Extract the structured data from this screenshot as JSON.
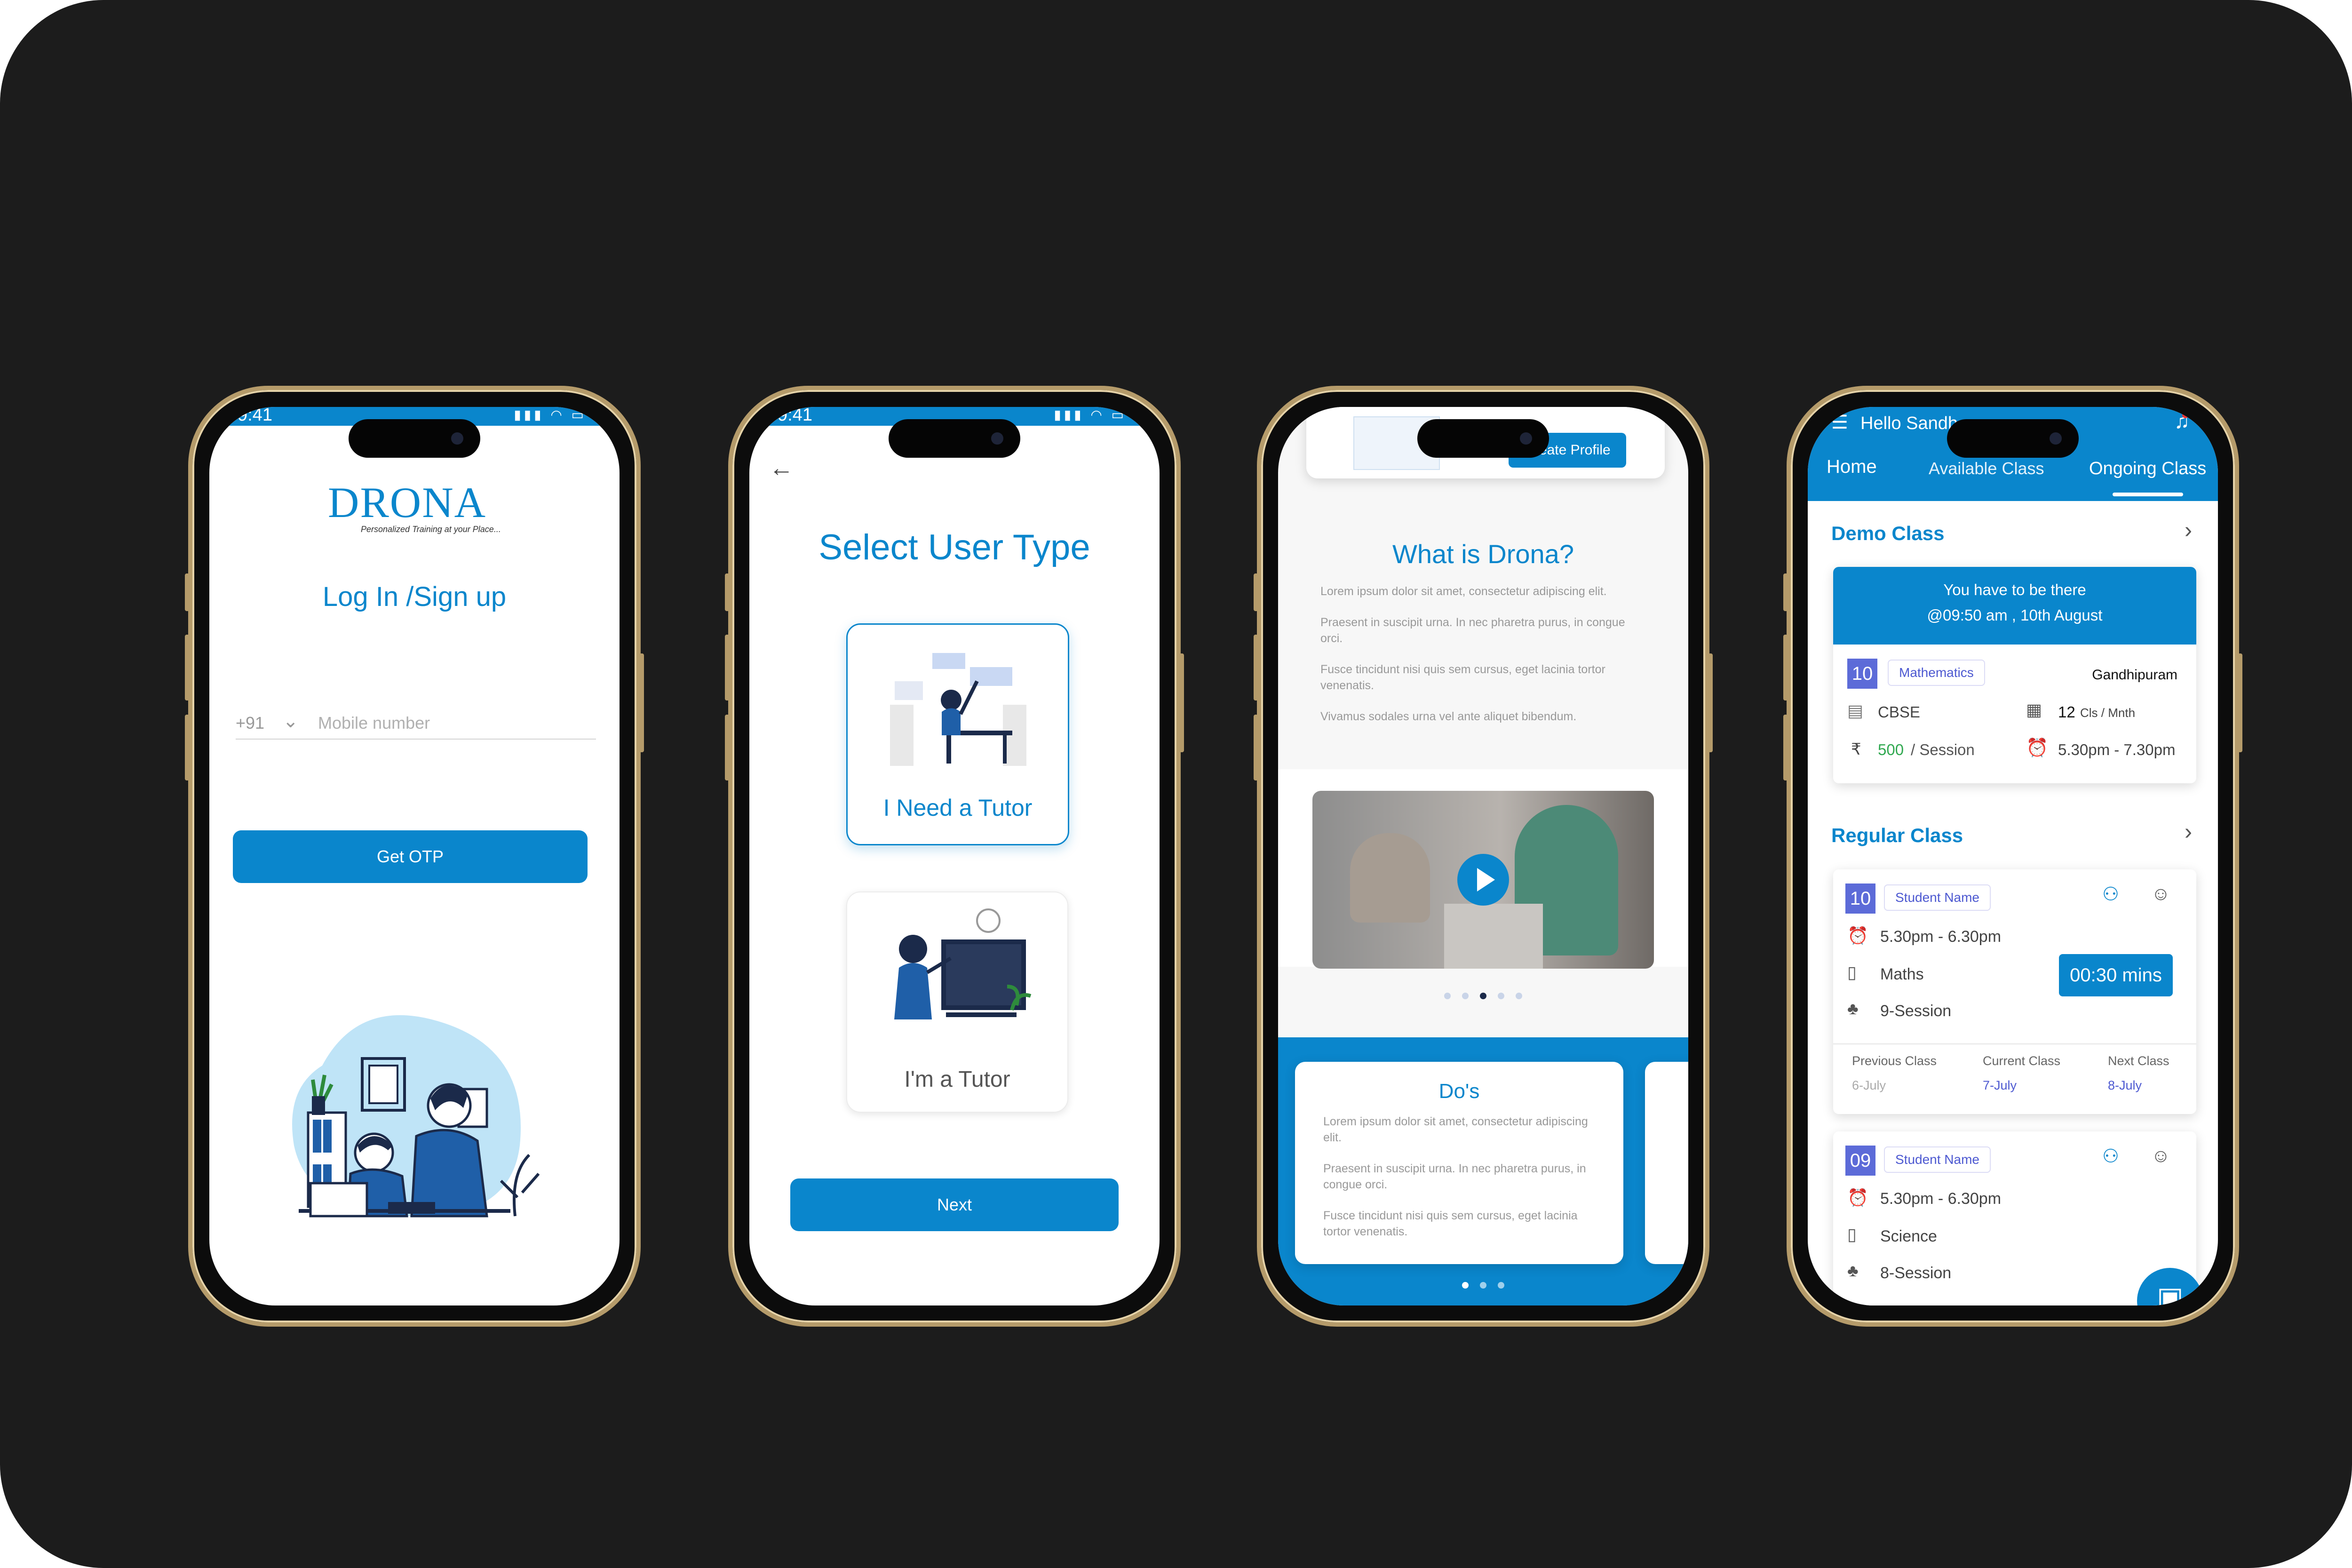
{
  "colors": {
    "brand": "#0a86cc",
    "background": "#1c1c1c",
    "accent_indigo": "#5c6bd8",
    "price_green": "#2fa84f"
  },
  "phone1": {
    "status_time": "9:41",
    "logo": "DRONA",
    "tagline": "Personalized Training at your Place...",
    "title": "Log In /Sign up",
    "country_code": "+91",
    "mobile_placeholder": "Mobile number",
    "otp_button": "Get OTP"
  },
  "phone2": {
    "status_time": "9:41",
    "title": "Select User Type",
    "option_student": "I Need a Tutor",
    "option_tutor": "I'm a Tutor",
    "next_button": "Next"
  },
  "phone3": {
    "top_button": "Create Profile",
    "title": "What is Drona?",
    "bullets": [
      "Lorem ipsum dolor sit amet, consectetur adipiscing elit.",
      "Praesent in suscipit urna. In nec pharetra purus, in congue orci.",
      "Fusce tincidunt nisi quis sem cursus, eget lacinia tortor venenatis.",
      "Vivamus sodales urna vel ante aliquet bibendum."
    ],
    "dos_title": "Do's",
    "dos_bullets": [
      "Lorem ipsum dolor sit amet, consectetur adipiscing elit.",
      "Praesent in suscipit urna. In nec pharetra purus, in congue orci.",
      "Fusce tincidunt nisi quis sem cursus, eget lacinia tortor venenatis."
    ]
  },
  "phone4": {
    "greeting": "Hello Sandh",
    "tabs": [
      "Home",
      "Available Class",
      "Ongoing Class"
    ],
    "demo_section": "Demo Class",
    "demo_notice_line1": "You have to be there",
    "demo_notice_line2": "@09:50 am , 10th August",
    "demo_grade": "10",
    "demo_subject": "Mathematics",
    "demo_location": "Gandhipuram",
    "demo_board": "CBSE",
    "demo_classes_count": "12",
    "demo_classes_unit": "Cls / Mnth",
    "demo_currency": "₹",
    "demo_price": "500",
    "demo_price_unit": "/ Session",
    "demo_time": "5.30pm - 7.30pm",
    "regular_section": "Regular Class",
    "class1": {
      "grade": "10",
      "name": "Student Name",
      "time": "5.30pm - 6.30pm",
      "subject": "Maths",
      "sessions": "9-Session",
      "timer": "00:30 mins",
      "prev_label": "Previous Class",
      "prev_value": "6-July",
      "curr_label": "Current Class",
      "curr_value": "7-July",
      "next_label": "Next Class",
      "next_value": "8-July"
    },
    "class2": {
      "grade": "09",
      "name": "Student Name",
      "time": "5.30pm - 6.30pm",
      "subject": "Science",
      "sessions": "8-Session"
    }
  }
}
